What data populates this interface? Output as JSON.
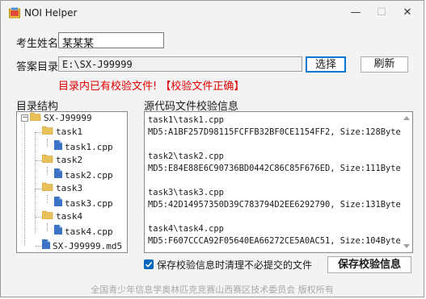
{
  "window": {
    "title": "NOI Helper",
    "minimize": "—",
    "maximize": "☐",
    "close": "✕"
  },
  "form": {
    "name_label": "考生姓名",
    "name_value": "某某某",
    "dir_label": "答案目录",
    "dir_value": "E:\\SX-J99999",
    "select_button": "选择",
    "refresh_button": "刷新",
    "status_text": "目录内已有校验文件! 【校验文件正确】"
  },
  "tree": {
    "label": "目录结构",
    "root": "SX-J99999",
    "nodes": [
      "task1",
      "task1.cpp",
      "task2",
      "task2.cpp",
      "task3",
      "task3.cpp",
      "task4",
      "task4.cpp",
      "SX-J99999.md5"
    ]
  },
  "info": {
    "label": "源代码文件校验信息",
    "text": "task1\\task1.cpp\nMD5:A1BF257D98115FCFFB32BF0CE1154FF2, Size:128Bytes\n\ntask2\\task2.cpp\nMD5:E84E88E6C90736BD0442C86C85F676ED, Size:111Bytes\n\ntask3\\task3.cpp\nMD5:42D14957350D39C783794D2EE6292790, Size:131Bytes\n\ntask4\\task4.cpp\nMD5:F607CCCA92F05640EA66272CE5A0AC51, Size:104Bytes"
  },
  "footer_controls": {
    "checkbox_label": "保存校验信息时清理不必提交的文件",
    "checkbox_checked": true,
    "save_button": "保存校验信息"
  },
  "copyright": "全国青少年信息学奥林匹克竞赛山西赛区技术委员会 版权所有",
  "colors": {
    "status_red": "#e00000",
    "accent_blue": "#0078d4",
    "folder_yellow": "#e8c15a",
    "file_blue": "#3b74c4"
  }
}
